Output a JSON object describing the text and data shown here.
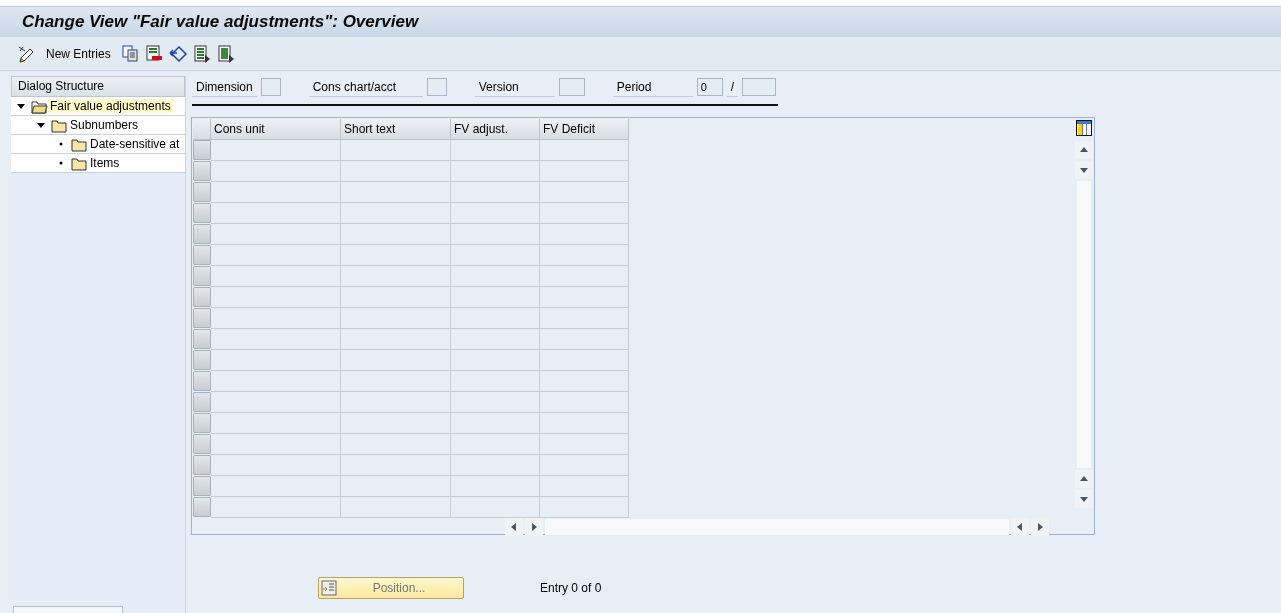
{
  "window": {
    "title": "Change View \"Fair value adjustments\": Overview"
  },
  "toolbar": {
    "items": [
      {
        "kind": "edit"
      },
      {
        "kind": "text",
        "label": "New Entries"
      },
      {
        "kind": "copy"
      },
      {
        "kind": "delete"
      },
      {
        "kind": "undo"
      },
      {
        "kind": "select"
      },
      {
        "kind": "deselect"
      }
    ]
  },
  "sidebar": {
    "title": "Dialog Structure",
    "items": [
      {
        "label": "Fair value adjustments",
        "selected": true,
        "expanded": true,
        "children": [
          {
            "label": "Subnumbers",
            "selected": false,
            "expanded": true,
            "children": [
              {
                "label": "Date-sensitive at",
                "selected": false
              },
              {
                "label": "Items",
                "selected": false
              }
            ]
          }
        ]
      }
    ]
  },
  "filters": [
    {
      "label": "Dimension"
    },
    {
      "label": "Cons chart/acct"
    },
    {
      "label": "Version"
    },
    {
      "label": "Period",
      "value": "0",
      "separator": "/"
    }
  ],
  "table": {
    "columns": [
      "Cons unit",
      "Short text",
      "FV adjust.",
      "FV Deficit"
    ]
  },
  "footer": {
    "button": "Position...",
    "status": "Entry 0 of 0"
  }
}
